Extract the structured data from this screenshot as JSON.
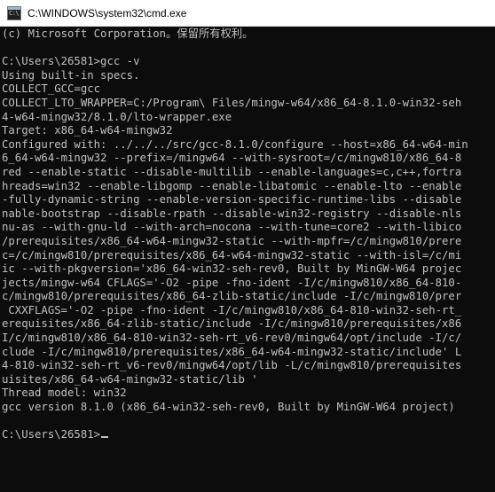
{
  "window": {
    "title": "C:\\WINDOWS\\system32\\cmd.exe",
    "icon_text": "C:\\"
  },
  "colors": {
    "background": "#0c0c0c",
    "foreground": "#c0c0c0",
    "titlebar": "#ffffff"
  },
  "console": {
    "lines": [
      "(c) Microsoft Corporation。保留所有权利。",
      "",
      "C:\\Users\\26581>gcc -v",
      "Using built-in specs.",
      "COLLECT_GCC=gcc",
      "COLLECT_LTO_WRAPPER=C:/Program\\ Files/mingw-w64/x86_64-8.1.0-win32-seh",
      "4-w64-mingw32/8.1.0/lto-wrapper.exe",
      "Target: x86_64-w64-mingw32",
      "Configured with: ../../../src/gcc-8.1.0/configure --host=x86_64-w64-min",
      "6_64-w64-mingw32 --prefix=/mingw64 --with-sysroot=/c/mingw810/x86_64-8",
      "red --enable-static --disable-multilib --enable-languages=c,c++,fortra",
      "hreads=win32 --enable-libgomp --enable-libatomic --enable-lto --enable",
      "-fully-dynamic-string --enable-version-specific-runtime-libs --disable",
      "nable-bootstrap --disable-rpath --disable-win32-registry --disable-nls",
      "nu-as --with-gnu-ld --with-arch=nocona --with-tune=core2 --with-libico",
      "/prerequisites/x86_64-w64-mingw32-static --with-mpfr=/c/mingw810/prere",
      "c=/c/mingw810/prerequisites/x86_64-w64-mingw32-static --with-isl=/c/mi",
      "ic --with-pkgversion='x86_64-win32-seh-rev0, Built by MinGW-W64 projec",
      "jects/mingw-w64 CFLAGS='-O2 -pipe -fno-ident -I/c/mingw810/x86_64-810-",
      "c/mingw810/prerequisites/x86_64-zlib-static/include -I/c/mingw810/prer",
      " CXXFLAGS='-O2 -pipe -fno-ident -I/c/mingw810/x86_64-810-win32-seh-rt_",
      "erequisites/x86_64-zlib-static/include -I/c/mingw810/prerequisites/x86",
      "I/c/mingw810/x86_64-810-win32-seh-rt_v6-rev0/mingw64/opt/include -I/c/",
      "clude -I/c/mingw810/prerequisites/x86_64-w64-mingw32-static/include' L",
      "4-810-win32-seh-rt_v6-rev0/mingw64/opt/lib -L/c/mingw810/prerequisites",
      "uisites/x86_64-w64-mingw32-static/lib '",
      "Thread model: win32",
      "gcc version 8.1.0 (x86_64-win32-seh-rev0, Built by MinGW-W64 project)",
      "",
      "C:\\Users\\26581>"
    ]
  }
}
